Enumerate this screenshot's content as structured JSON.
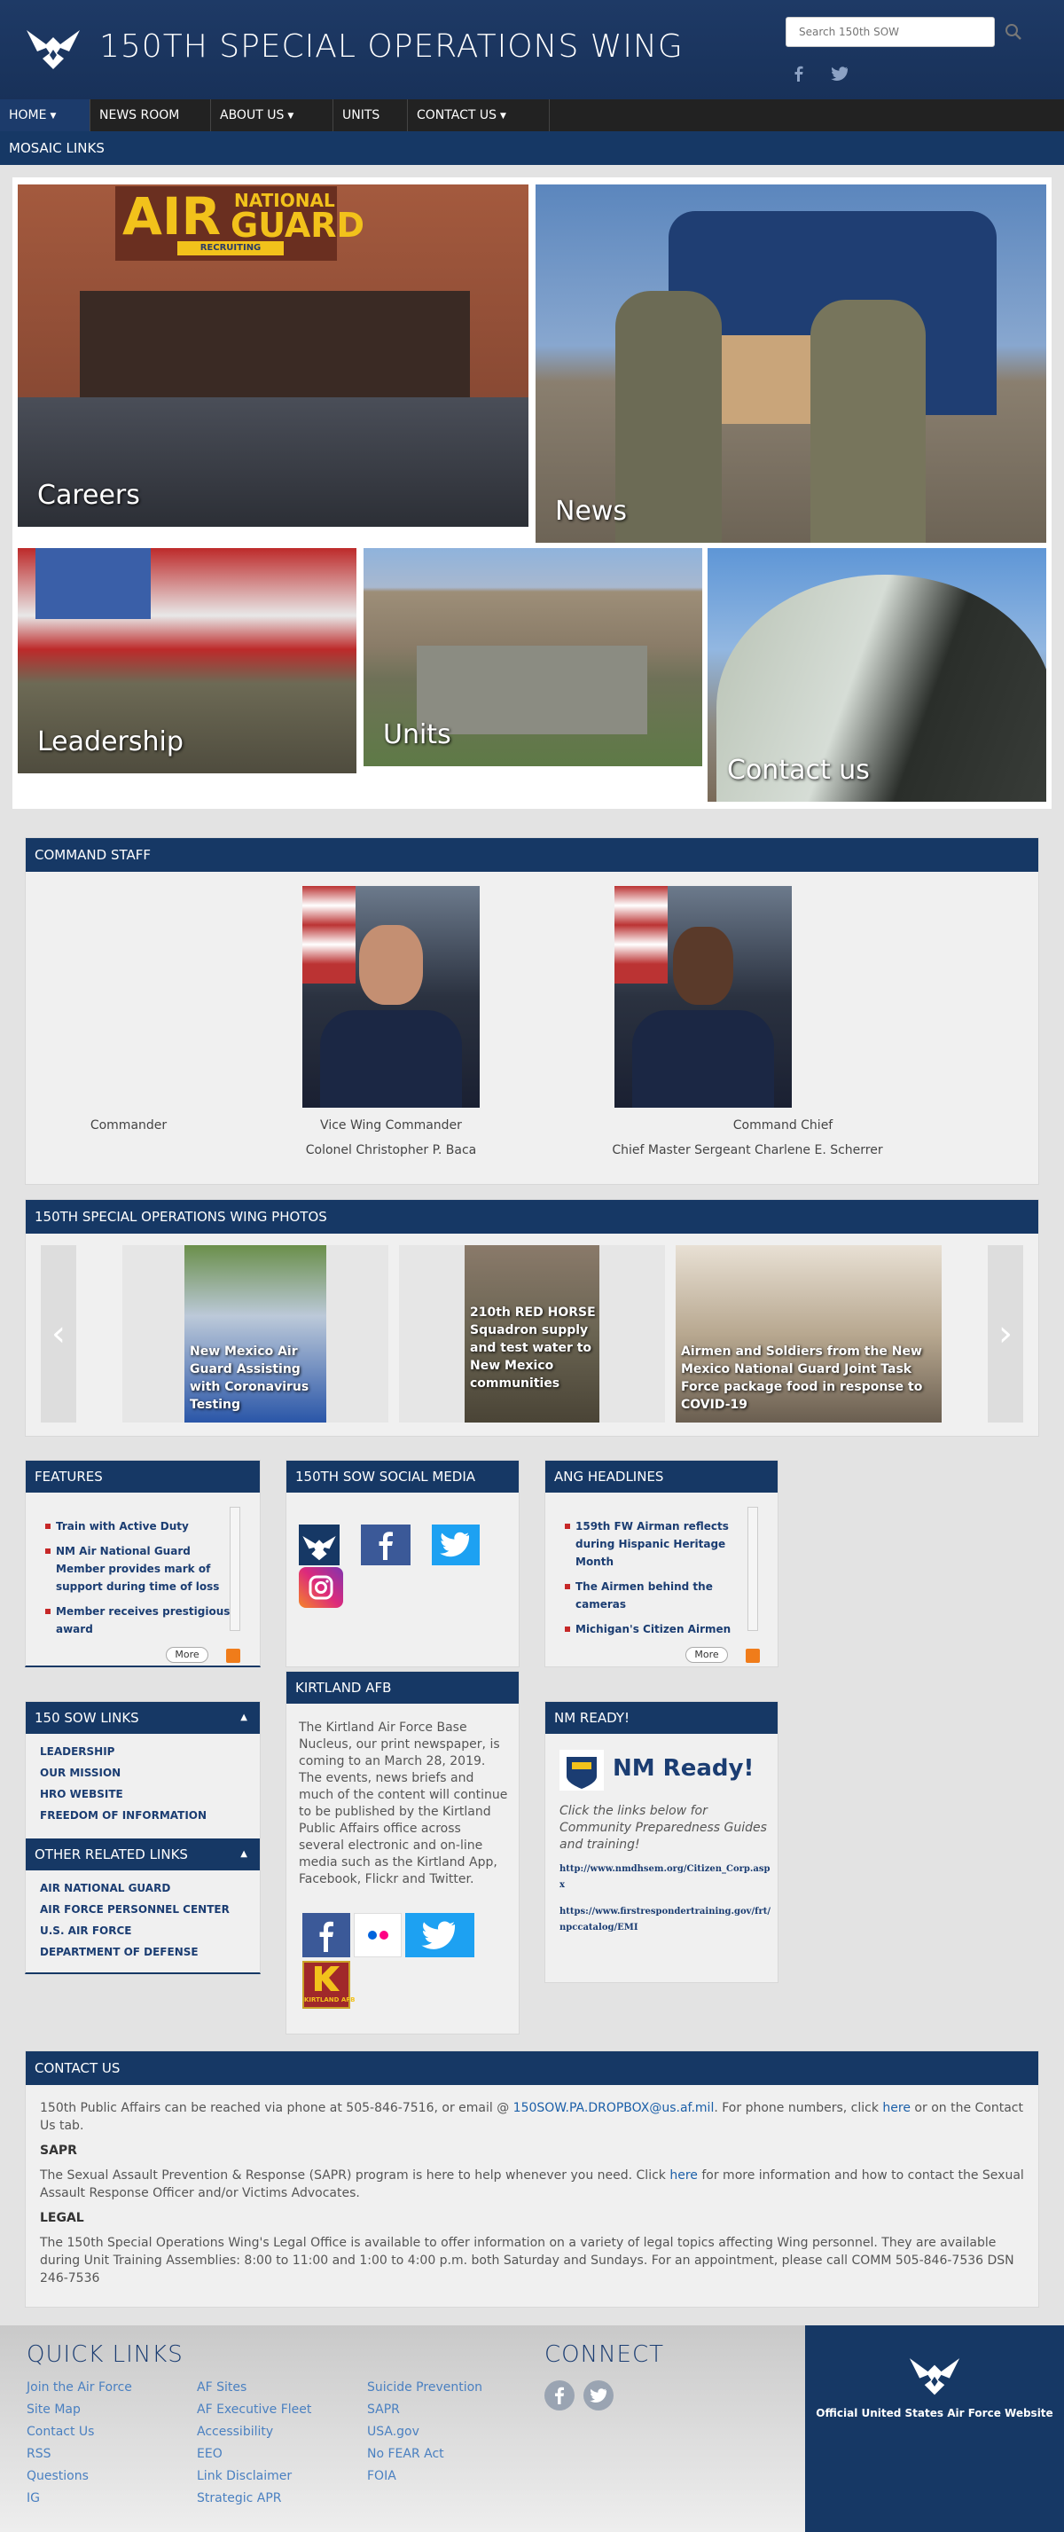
{
  "header": {
    "site_title": "150TH SPECIAL OPERATIONS WING",
    "search_placeholder": "Search 150th SOW"
  },
  "nav": [
    {
      "label": "HOME",
      "dropdown": true
    },
    {
      "label": "NEWS ROOM",
      "dropdown": false
    },
    {
      "label": "ABOUT US",
      "dropdown": true
    },
    {
      "label": "UNITS",
      "dropdown": false
    },
    {
      "label": "CONTACT US",
      "dropdown": true
    }
  ],
  "mosaic": {
    "title": "MOSAIC LINKS",
    "tiles": [
      "Careers",
      "News",
      "Leadership",
      "Units",
      "Contact us"
    ],
    "sign_air": "AIR",
    "sign_national": "NATIONAL",
    "sign_guard": "GUARD",
    "sign_recruiting": "RECRUITING"
  },
  "command_staff": {
    "title": "COMMAND STAFF",
    "commander": "Commander",
    "vice_title": "Vice Wing Commander",
    "vice_name": "Colonel Christopher P. Baca",
    "chief_title": "Command Chief",
    "chief_name": "Chief Master Sergeant Charlene E. Scherrer"
  },
  "photos": {
    "title": "150TH SPECIAL OPERATIONS WING PHOTOS",
    "items": [
      "New Mexico Air Guard Assisting with Coronavirus Testing",
      "210th RED HORSE Squadron supply and test water to New Mexico communities",
      "Airmen and Soldiers from the New Mexico National Guard Joint Task Force package food in response to COVID-19"
    ]
  },
  "features": {
    "title": "FEATURES",
    "items": [
      "Train with Active Duty",
      "NM Air National Guard Member provides mark of support during time of loss",
      "Member receives prestigious award"
    ],
    "more": "More"
  },
  "social": {
    "title": "150TH SOW SOCIAL MEDIA"
  },
  "ang": {
    "title": "ANG HEADLINES",
    "items": [
      "159th FW Airman reflects during Hispanic Heritage Month",
      "The Airmen behind the cameras",
      "Michigan's Citizen Airmen"
    ],
    "more": "More"
  },
  "sow_links": {
    "title": "150 SOW LINKS",
    "items": [
      "LEADERSHIP",
      "OUR MISSION",
      "HRO WEBSITE",
      "FREEDOM OF INFORMATION"
    ]
  },
  "other_links": {
    "title": "OTHER RELATED LINKS",
    "items": [
      "AIR NATIONAL GUARD",
      "AIR FORCE PERSONNEL CENTER",
      "U.S. AIR FORCE",
      "DEPARTMENT OF DEFENSE"
    ]
  },
  "kirtland": {
    "title": "KIRTLAND AFB",
    "text": "The Kirtland Air Force Base Nucleus, our print newspaper, is coming to an March 28, 2019. The events, news briefs and much of the content will continue to be published by the Kirtland Public Affairs office across several electronic and on-line media such as the Kirtland App, Facebook, Flickr and Twitter.",
    "badge_text": "KIRTLAND AFB"
  },
  "nm_ready": {
    "title": "NM READY!",
    "heading": "NM Ready!",
    "text": "Click the links below for Community Preparedness Guides and training!",
    "link1": "http://www.nmdhsem.org/Citizen_Corp.aspx",
    "link2": "https://www.firstrespondertraining.gov/frt/npccatalog/EMI"
  },
  "contact": {
    "title": "CONTACT US",
    "p1_a": "150th Public Affairs can be reached via phone at 505-846-7516, or email @ ",
    "p1_email": "150SOW.PA.DROPBOX@us.af.mil",
    "p1_b": ". For phone numbers, click ",
    "p1_here": "here",
    "p1_c": " or on the Contact Us tab.",
    "sapr_title": "SAPR",
    "sapr_a": "The Sexual Assault Prevention & Response (SAPR) program is here to help whenever you need. Click ",
    "sapr_here": "here",
    "sapr_b": " for more information and how to contact the Sexual Assault Response Officer and/or Victims Advocates.",
    "legal_title": "LEGAL",
    "legal_text": "The 150th Special Operations Wing's Legal Office is available to offer information on a variety of legal topics affecting Wing personnel. They are available during Unit Training Assemblies: 8:00 to 11:00 and 1:00 to 4:00 p.m. both Saturday and Sundays. For an appointment, please call COMM 505-846-7536 DSN 246-7536"
  },
  "footer": {
    "quick_links_title": "QUICK LINKS",
    "col1": [
      "Join the Air Force",
      "Site Map",
      "Contact Us",
      "RSS",
      "Questions",
      "IG"
    ],
    "col2": [
      "AF Sites",
      "AF Executive Fleet",
      "Accessibility",
      "EEO",
      "Link Disclaimer",
      "Strategic APR"
    ],
    "col3": [
      "Suicide Prevention",
      "SAPR",
      "USA.gov",
      "No FEAR Act",
      "FOIA"
    ],
    "connect_title": "CONNECT",
    "official": "Official United States Air Force Website"
  },
  "colors": {
    "navy": "#163865",
    "link": "#1b3d72",
    "bullet": "#c62828"
  }
}
